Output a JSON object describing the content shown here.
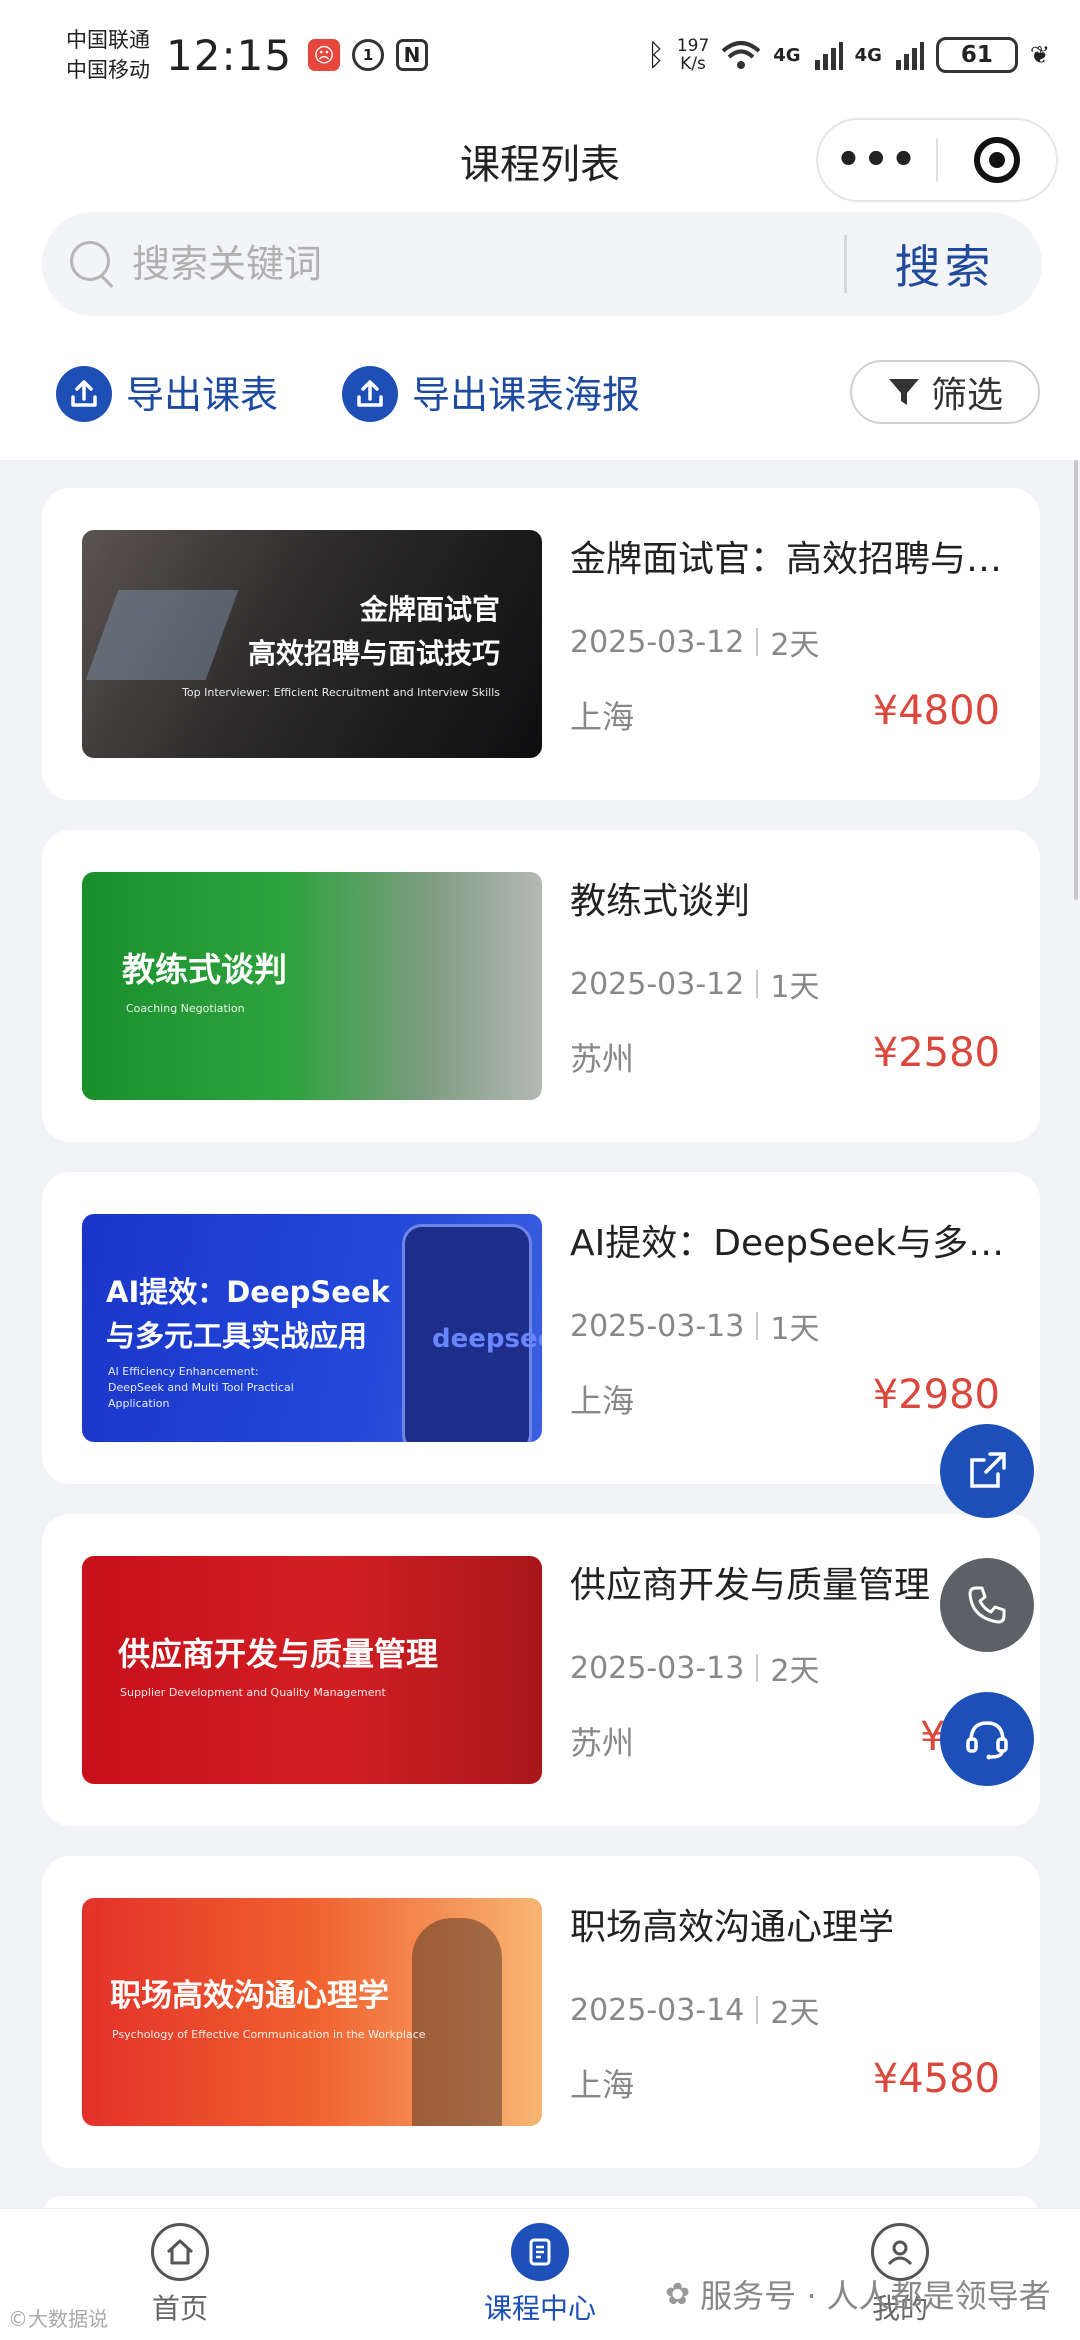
{
  "status_bar": {
    "carrier1": "中国联通",
    "carrier2": "中国移动",
    "time": "12:15",
    "speed_value": "197",
    "speed_unit": "K/s",
    "net1": "4G",
    "net2": "4G",
    "battery": "61"
  },
  "nav": {
    "title": "课程列表",
    "more": "•••"
  },
  "search": {
    "placeholder": "搜索关键词",
    "button": "搜索"
  },
  "actions": {
    "export_schedule": "导出课表",
    "export_poster": "导出课表海报",
    "filter": "筛选"
  },
  "courses": [
    {
      "title": "金牌面试官：高效招聘与面试技巧",
      "date": "2025-03-12",
      "duration": "2天",
      "city": "上海",
      "price": "¥4800",
      "thumb_line1": "金牌面试官",
      "thumb_line2": "高效招聘与面试技巧",
      "thumb_en": "Top Interviewer: Efficient Recruitment and Interview Skills",
      "thumb_color": "#1b1b1e"
    },
    {
      "title": "教练式谈判",
      "date": "2025-03-12",
      "duration": "1天",
      "city": "苏州",
      "price": "¥2580",
      "thumb_line1": "教练式谈判",
      "thumb_en": "Coaching Negotiation",
      "thumb_color": "#1f9a35"
    },
    {
      "title": "AI提效：DeepSeek与多元工具实战应用",
      "date": "2025-03-13",
      "duration": "1天",
      "city": "上海",
      "price": "¥2980",
      "thumb_line1": "AI提效：DeepSeek",
      "thumb_line2": "与多元工具实战应用",
      "thumb_en": "AI Efficiency Enhancement: DeepSeek and Multi Tool Practical Application",
      "thumb_logo": "deepseek",
      "thumb_color": "#1d3bd0"
    },
    {
      "title": "供应商开发与质量管理",
      "date": "2025-03-13",
      "duration": "2天",
      "city": "苏州",
      "price": "¥48",
      "thumb_line1": "供应商开发与质量管理",
      "thumb_en": "Supplier Development and Quality Management",
      "thumb_color": "#c8121b"
    },
    {
      "title": "职场高效沟通心理学",
      "date": "2025-03-14",
      "duration": "2天",
      "city": "上海",
      "price": "¥4580",
      "thumb_line1": "职场高效沟通心理学",
      "thumb_en": "Psychology of Effective Communication in the Workplace",
      "thumb_color": "#e8442a"
    }
  ],
  "tabbar": {
    "home": "首页",
    "courses": "课程中心",
    "mine": "我的"
  },
  "watermark": "服务号 · 人人都是领导者",
  "watermark_left": "©大数据说"
}
